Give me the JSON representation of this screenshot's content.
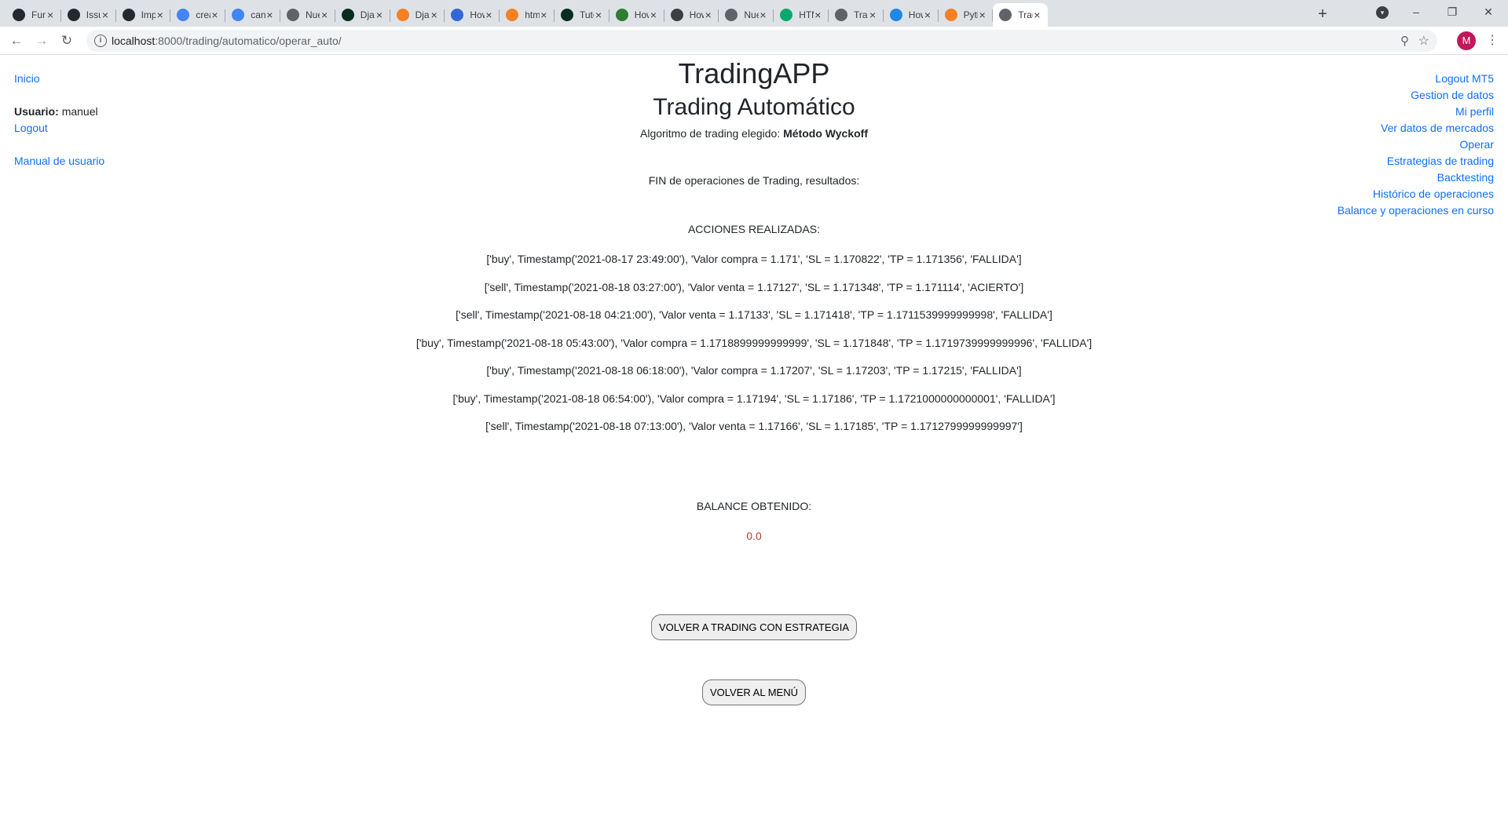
{
  "browser": {
    "tabs": [
      {
        "label": "Func",
        "icon": "github-icon",
        "color": "#24292e"
      },
      {
        "label": "Issu",
        "icon": "github-icon",
        "color": "#24292e"
      },
      {
        "label": "Impl",
        "icon": "github-icon",
        "color": "#24292e"
      },
      {
        "label": "crea",
        "icon": "google-icon",
        "color": "#4285f4"
      },
      {
        "label": "canr",
        "icon": "google-icon",
        "color": "#4285f4"
      },
      {
        "label": "Nue",
        "icon": "chrome-icon",
        "color": "#5f6368"
      },
      {
        "label": "Djar",
        "icon": "django-icon",
        "color": "#092e20"
      },
      {
        "label": "Djar",
        "icon": "stackoverflow-icon",
        "color": "#f48024"
      },
      {
        "label": "How",
        "icon": "quora-icon",
        "color": "#3367d6"
      },
      {
        "label": "htm",
        "icon": "stackoverflow-icon",
        "color": "#f48024"
      },
      {
        "label": "Tuto",
        "icon": "django-icon",
        "color": "#092e20"
      },
      {
        "label": "How",
        "icon": "wikihow-icon",
        "color": "#2e7d32"
      },
      {
        "label": "How",
        "icon": "diamond-icon",
        "color": "#3c4043"
      },
      {
        "label": "Nue",
        "icon": "chrome-icon",
        "color": "#5f6368"
      },
      {
        "label": "HTM",
        "icon": "w3schools-icon",
        "color": "#04aa6d"
      },
      {
        "label": "Trad",
        "icon": "globe-icon",
        "color": "#5f6368"
      },
      {
        "label": "How",
        "icon": "s-icon",
        "color": "#1e88e5"
      },
      {
        "label": "Pyth",
        "icon": "stackoverflow-icon",
        "color": "#f48024"
      },
      {
        "label": "Trad",
        "icon": "globe-icon",
        "color": "#5f6368",
        "active": true
      }
    ],
    "url_host": "localhost",
    "url_path": ":8000/trading/automatico/operar_auto/",
    "profile_initial": "M"
  },
  "left_nav": {
    "inicio": "Inicio",
    "user_label": "Usuario:",
    "user_name": "manuel",
    "logout": "Logout",
    "manual": "Manual de usuario"
  },
  "right_nav": {
    "items": [
      "Logout MT5",
      "Gestion de datos",
      "Mi perfil",
      "Ver datos de mercados",
      "Operar",
      "Estrategias de trading",
      "Backtesting",
      "Histórico de operaciones",
      "Balance y operaciones en curso"
    ]
  },
  "main": {
    "app_title": "TradingAPP",
    "page_title": "Trading Automático",
    "algo_label": "Algoritmo de trading elegido:",
    "algo_name": "Método Wyckoff",
    "fin_text": "FIN de operaciones de Trading, resultados:",
    "acciones_label": "ACCIONES REALIZADAS:",
    "actions": [
      "['buy', Timestamp('2021-08-17 23:49:00'), 'Valor compra = 1.171', 'SL = 1.170822', 'TP = 1.171356', 'FALLIDA']",
      "['sell', Timestamp('2021-08-18 03:27:00'), 'Valor venta = 1.17127', 'SL = 1.171348', 'TP = 1.171114', 'ACIERTO']",
      "['sell', Timestamp('2021-08-18 04:21:00'), 'Valor venta = 1.17133', 'SL = 1.171418', 'TP = 1.1711539999999998', 'FALLIDA']",
      "['buy', Timestamp('2021-08-18 05:43:00'), 'Valor compra = 1.1718899999999999', 'SL = 1.171848', 'TP = 1.1719739999999996', 'FALLIDA']",
      "['buy', Timestamp('2021-08-18 06:18:00'), 'Valor compra = 1.17207', 'SL = 1.17203', 'TP = 1.17215', 'FALLIDA']",
      "['buy', Timestamp('2021-08-18 06:54:00'), 'Valor compra = 1.17194', 'SL = 1.17186', 'TP = 1.1721000000000001', 'FALLIDA']",
      "['sell', Timestamp('2021-08-18 07:13:00'), 'Valor venta = 1.17166', 'SL = 1.17185', 'TP = 1.1712799999999997']"
    ],
    "balance_label": "BALANCE OBTENIDO:",
    "balance_value": "0.0",
    "btn_volver_estrategia": "VOLVER A TRADING CON ESTRATEGIA",
    "btn_volver_menu": "VOLVER AL MENÚ"
  },
  "colors": {
    "link": "#0d6efd",
    "balance": "#c0392b"
  }
}
